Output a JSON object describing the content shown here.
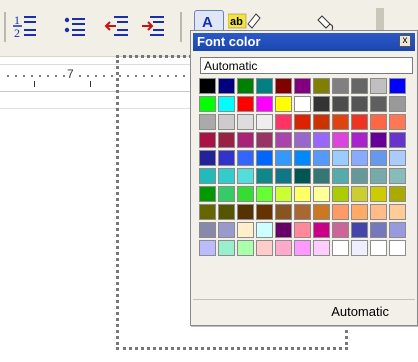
{
  "toolbar": {
    "buttons": [
      {
        "name": "numbering-icon"
      },
      {
        "name": "bullets-icon"
      },
      {
        "name": "decrease-indent-icon"
      },
      {
        "name": "increase-indent-icon"
      },
      {
        "name": "font-color-icon"
      },
      {
        "name": "highlight-icon"
      },
      {
        "name": "background-color-icon"
      }
    ],
    "colors": {
      "bg": "#f1efe6",
      "active_bg": "#dfe6f5",
      "accent_red": "#cc1010",
      "accent_blue": "#1a2fae"
    }
  },
  "ruler": {
    "number": "7"
  },
  "popup": {
    "title": "Font color",
    "close_label": "x",
    "input_value": "Automatic",
    "automatic_label": "Automatic",
    "title_color": "#2251c4",
    "palette": [
      [
        "#000000",
        "#000080",
        "#008000",
        "#008080",
        "#800000",
        "#800080",
        "#808000",
        "#808080",
        "#666666",
        "#c0c0c0",
        "#0000ff"
      ],
      [
        "#00ff00",
        "#00ffff",
        "#ff0000",
        "#ff00ff",
        "#ffff00",
        "#ffffff",
        "#333333",
        "#4d4d4d",
        "#555555",
        "#5f5f5f",
        "#999999"
      ],
      [
        "#aaaaaa",
        "#cccccc",
        "#dddddd",
        "#eeeeee",
        "#ff3366",
        "#dd2200",
        "#cc3300",
        "#dd4411",
        "#ee3322",
        "#ff6644",
        "#ff7755"
      ],
      [
        "#aa1144",
        "#992244",
        "#aa2277",
        "#993366",
        "#aa44aa",
        "#9966cc",
        "#9966ff",
        "#dd44dd",
        "#aa22cc",
        "#660099",
        "#6633cc"
      ],
      [
        "#222299",
        "#3333cc",
        "#3366ff",
        "#0066ff",
        "#3399ff",
        "#0088ff",
        "#5599ff",
        "#99ccff",
        "#88aaff",
        "#6699ee",
        "#aaccff"
      ],
      [
        "#22bbbb",
        "#33cccc",
        "#55dddd",
        "#118888",
        "#117788",
        "#005555",
        "#337777",
        "#55aaaa",
        "#669999",
        "#77aaaa",
        "#88bbbb"
      ],
      [
        "#009900",
        "#33cc66",
        "#33dd33",
        "#66ff33",
        "#ccff33",
        "#ffff66",
        "#ffff99",
        "#aacc00",
        "#cccc33",
        "#cccc00",
        "#aaaa00"
      ],
      [
        "#666600",
        "#555500",
        "#553300",
        "#663300",
        "#885522",
        "#aa6633",
        "#cc7722",
        "#ff9966",
        "#ffaa66",
        "#ffbb88",
        "#ffcc99"
      ],
      [
        "#8888aa",
        "#9999cc",
        "#ffeecc",
        "#ccffff",
        "#660066",
        "#ff8899",
        "#cc0088",
        "#cc6699",
        "#4444aa",
        "#7777bb",
        "#9999dd"
      ],
      [
        "#bbbbff",
        "#99eecc",
        "#aaffaa",
        "#ffcccc",
        "#ffaacc",
        "#ff99ff",
        "#ffccff",
        "#ffffff",
        "#eeeeff",
        "#ffffff",
        "#ffffff"
      ]
    ]
  }
}
